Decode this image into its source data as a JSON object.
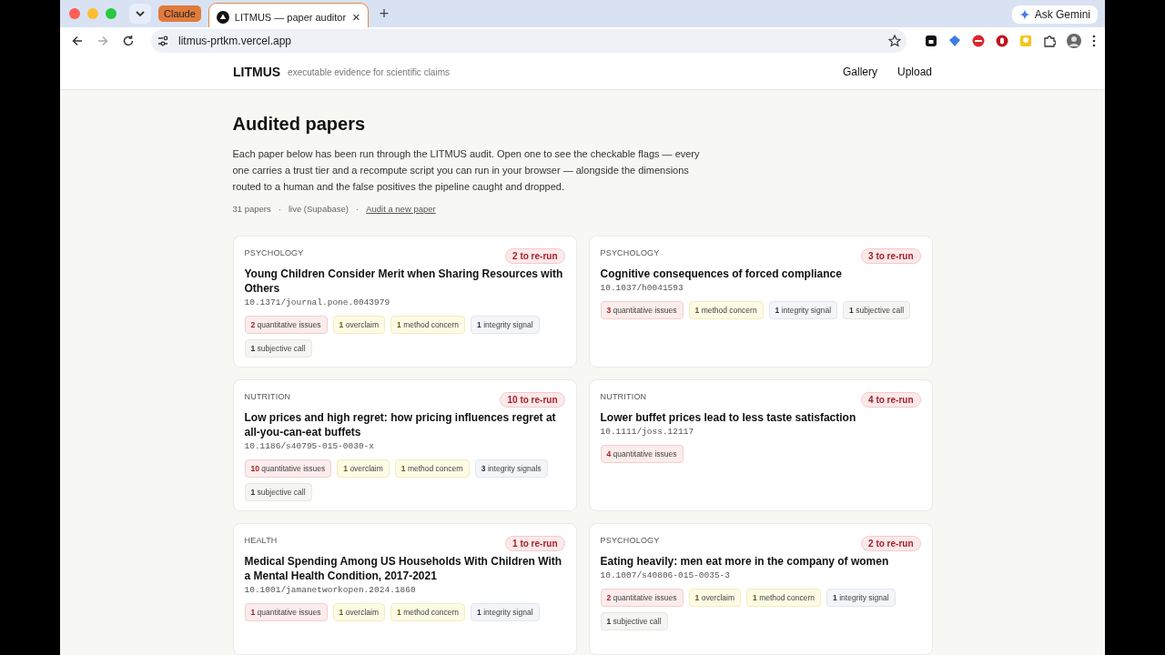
{
  "browser": {
    "tab_group": "Claude",
    "tab": {
      "title": "LITMUS — paper auditor",
      "close": "×"
    },
    "new_tab": "+",
    "url": "litmus-prtkm.vercel.app",
    "ask": "Ask Gemini"
  },
  "site": {
    "brand": "LITMUS",
    "tagline": "executable evidence for scientific claims",
    "nav": [
      "Gallery",
      "Upload"
    ]
  },
  "heading": "Audited papers",
  "intro": "Each paper below has been run through the LITMUS audit. Open one to see the checkable flags — every one carries a trust tier and a recompute script you can run in your browser — alongside the dimensions routed to a human and the false positives the pipeline caught and dropped.",
  "meta": {
    "separator": "·",
    "items": [
      {
        "kind": "text",
        "text": "31 papers"
      },
      {
        "kind": "text",
        "text": "live (Supabase)"
      },
      {
        "kind": "link",
        "text": "Audit a new paper"
      }
    ]
  },
  "papers": [
    {
      "field": "PSYCHOLOGY",
      "rerun": "2 to re-run",
      "title": "Young Children Consider Merit when Sharing Resources with Others",
      "doi": "10.1371/journal.pone.0043979",
      "flags": [
        {
          "kind": "quantitative",
          "count": "2",
          "label": "quantitative issues"
        },
        {
          "kind": "overclaim",
          "count": "1",
          "label": "overclaim"
        },
        {
          "kind": "method",
          "count": "1",
          "label": "method concern"
        },
        {
          "kind": "integrity",
          "count": "1",
          "label": "integrity signal"
        },
        {
          "kind": "subjective",
          "count": "1",
          "label": "subjective call"
        }
      ]
    },
    {
      "field": "PSYCHOLOGY",
      "rerun": "3 to re-run",
      "title": "Cognitive consequences of forced compliance",
      "doi": "10.1037/h0041593",
      "flags": [
        {
          "kind": "quantitative",
          "count": "3",
          "label": "quantitative issues"
        },
        {
          "kind": "method",
          "count": "1",
          "label": "method concern"
        },
        {
          "kind": "integrity",
          "count": "1",
          "label": "integrity signal"
        },
        {
          "kind": "subjective",
          "count": "1",
          "label": "subjective call"
        }
      ]
    },
    {
      "field": "NUTRITION",
      "rerun": "10 to re-run",
      "title": "Low prices and high regret: how pricing influences regret at all-you-can-eat buffets",
      "doi": "10.1186/s40795-015-0030-x",
      "flags": [
        {
          "kind": "quantitative",
          "count": "10",
          "label": "quantitative issues"
        },
        {
          "kind": "overclaim",
          "count": "1",
          "label": "overclaim"
        },
        {
          "kind": "method",
          "count": "1",
          "label": "method concern"
        },
        {
          "kind": "integrity",
          "count": "3",
          "label": "integrity signals"
        },
        {
          "kind": "subjective",
          "count": "1",
          "label": "subjective call"
        }
      ]
    },
    {
      "field": "NUTRITION",
      "rerun": "4 to re-run",
      "title": "Lower buffet prices lead to less taste satisfaction",
      "doi": "10.1111/joss.12117",
      "flags": [
        {
          "kind": "quantitative",
          "count": "4",
          "label": "quantitative issues"
        }
      ]
    },
    {
      "field": "HEALTH",
      "rerun": "1 to re-run",
      "title": "Medical Spending Among US Households With Children With a Mental Health Condition, 2017-2021",
      "doi": "10.1001/jamanetworkopen.2024.1860",
      "flags": [
        {
          "kind": "quantitative",
          "count": "1",
          "label": "quantitative issues"
        },
        {
          "kind": "overclaim",
          "count": "1",
          "label": "overclaim"
        },
        {
          "kind": "method",
          "count": "1",
          "label": "method concern"
        },
        {
          "kind": "integrity",
          "count": "1",
          "label": "integrity signal"
        }
      ]
    },
    {
      "field": "PSYCHOLOGY",
      "rerun": "2 to re-run",
      "title": "Eating heavily: men eat more in the company of women",
      "doi": "10.1007/s40806-015-0035-3",
      "flags": [
        {
          "kind": "quantitative",
          "count": "2",
          "label": "quantitative issues"
        },
        {
          "kind": "overclaim",
          "count": "1",
          "label": "overclaim"
        },
        {
          "kind": "method",
          "count": "1",
          "label": "method concern"
        },
        {
          "kind": "integrity",
          "count": "1",
          "label": "integrity signal"
        },
        {
          "kind": "subjective",
          "count": "1",
          "label": "subjective call"
        }
      ]
    }
  ]
}
